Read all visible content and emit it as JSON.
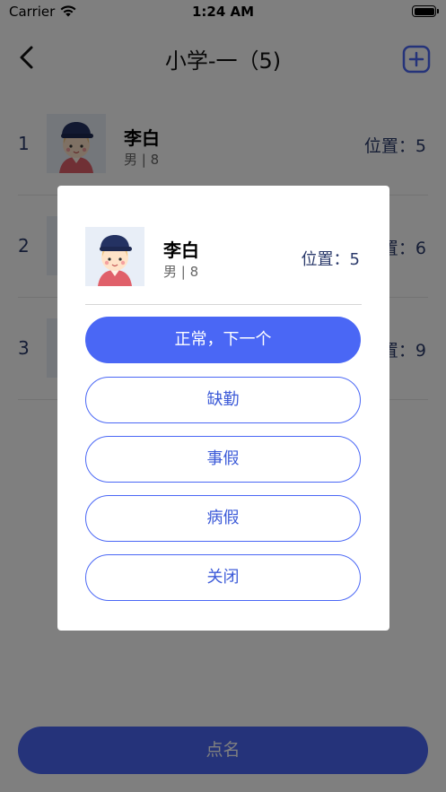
{
  "status_bar": {
    "carrier": "Carrier",
    "time": "1:24 AM",
    "wifi_icon": "wifi-icon",
    "battery_icon": "battery-icon"
  },
  "nav": {
    "title": "小学-一（5)",
    "back_icon": "chevron-left-icon",
    "add_icon": "plus-square-icon",
    "accent_color": "#4a67f5"
  },
  "students": [
    {
      "index": "1",
      "name": "李白",
      "meta": "男 | 8",
      "position": "位置：5"
    },
    {
      "index": "2",
      "name": "",
      "meta": "",
      "position": "置：6"
    },
    {
      "index": "3",
      "name": "",
      "meta": "",
      "position": "置：9"
    }
  ],
  "call_button": {
    "label": "点名"
  },
  "modal": {
    "name": "李白",
    "meta": "男 | 8",
    "position": "位置：5",
    "buttons": {
      "normal_next": "正常，下一个",
      "absent": "缺勤",
      "personal_leave": "事假",
      "sick_leave": "病假",
      "close": "关闭"
    },
    "primary_color": "#4a67f5"
  }
}
